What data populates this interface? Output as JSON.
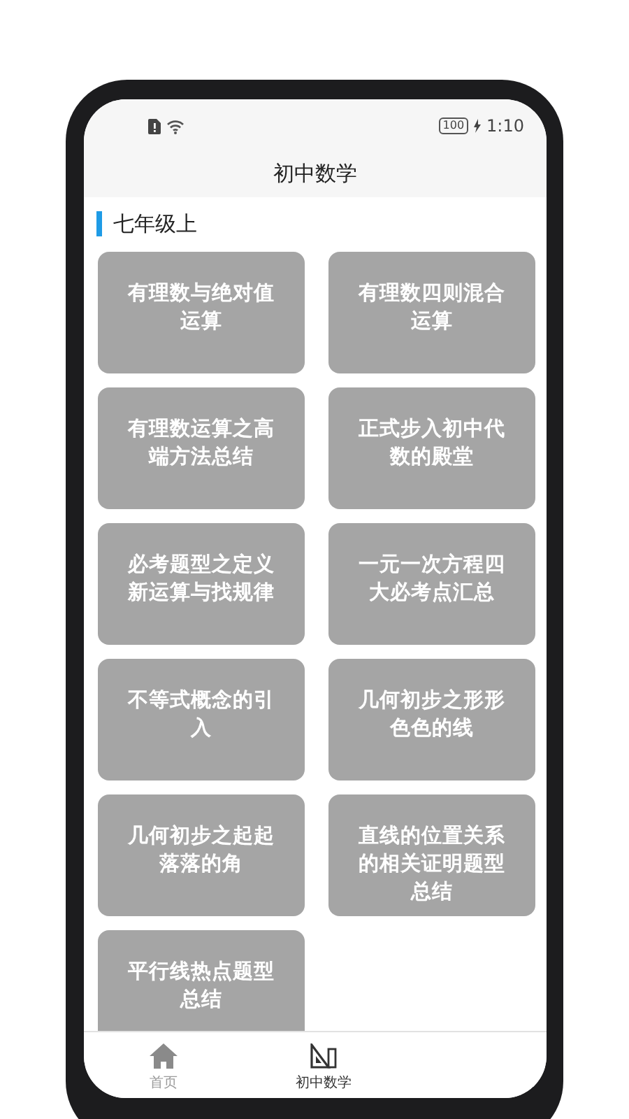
{
  "status_bar": {
    "battery": "100",
    "time": "1:10"
  },
  "header": {
    "title": "初中数学"
  },
  "section": {
    "title": "七年级上"
  },
  "cards": [
    {
      "label": "有理数与绝对值运算"
    },
    {
      "label": "有理数四则混合运算"
    },
    {
      "label": "有理数运算之高端方法总结"
    },
    {
      "label": "正式步入初中代数的殿堂"
    },
    {
      "label": "必考题型之定义新运算与找规律"
    },
    {
      "label": "一元一次方程四大必考点汇总"
    },
    {
      "label": "不等式概念的引入"
    },
    {
      "label": "几何初步之形形色色的线"
    },
    {
      "label": "几何初步之起起落落的角"
    },
    {
      "label": "直线的位置关系的相关证明题型总结"
    },
    {
      "label": "平行线热点题型总结"
    }
  ],
  "bottom_nav": [
    {
      "label": "首页",
      "kind": "home",
      "selected": false
    },
    {
      "label": "初中数学",
      "kind": "ruler",
      "selected": true
    }
  ]
}
